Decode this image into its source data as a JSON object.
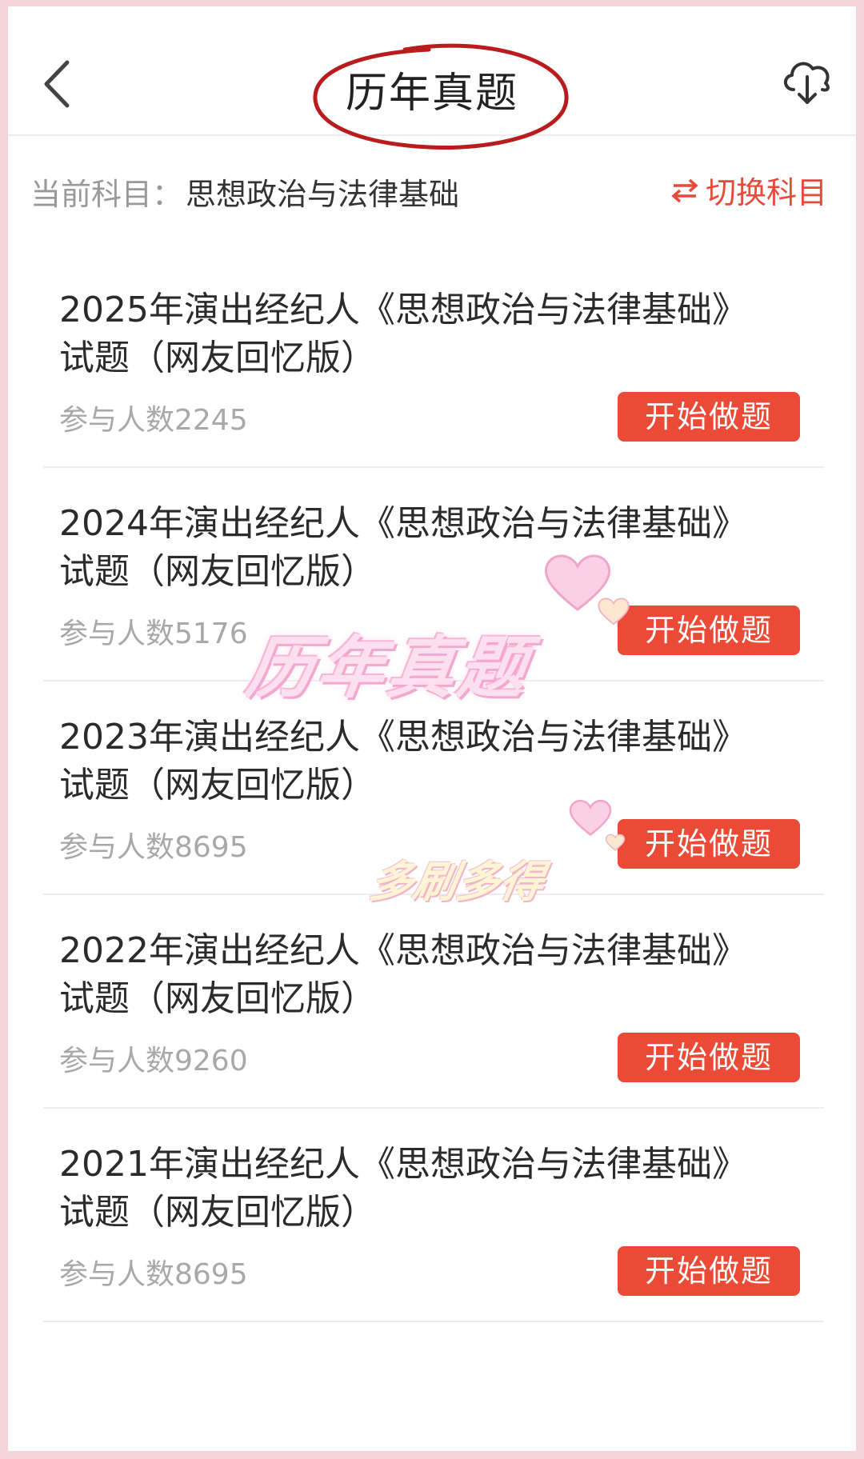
{
  "header": {
    "title": "历年真题"
  },
  "subject": {
    "label": "当前科目：",
    "value": "思想政治与法律基础",
    "switch_label": "切换科目"
  },
  "exams": [
    {
      "title": "2025年演出经纪人《思想政治与法律基础》试题（网友回忆版）",
      "count": "参与人数2245",
      "button": "开始做题"
    },
    {
      "title": "2024年演出经纪人《思想政治与法律基础》试题（网友回忆版）",
      "count": "参与人数5176",
      "button": "开始做题"
    },
    {
      "title": "2023年演出经纪人《思想政治与法律基础》试题（网友回忆版）",
      "count": "参与人数8695",
      "button": "开始做题"
    },
    {
      "title": "2022年演出经纪人《思想政治与法律基础》试题（网友回忆版）",
      "count": "参与人数9260",
      "button": "开始做题"
    },
    {
      "title": "2021年演出经纪人《思想政治与法律基础》试题（网友回忆版）",
      "count": "参与人数8695",
      "button": "开始做题"
    }
  ],
  "overlay": {
    "big_text": "历年真题",
    "small_text": "多刷多得"
  },
  "colors": {
    "accent": "#ea4a36",
    "annotation_circle": "#b81c1c",
    "border": "#f3d3dc"
  },
  "icons": {
    "back": "chevron-left-icon",
    "download": "cloud-download-icon",
    "switch": "swap-arrows-icon",
    "heart": "heart-icon"
  }
}
